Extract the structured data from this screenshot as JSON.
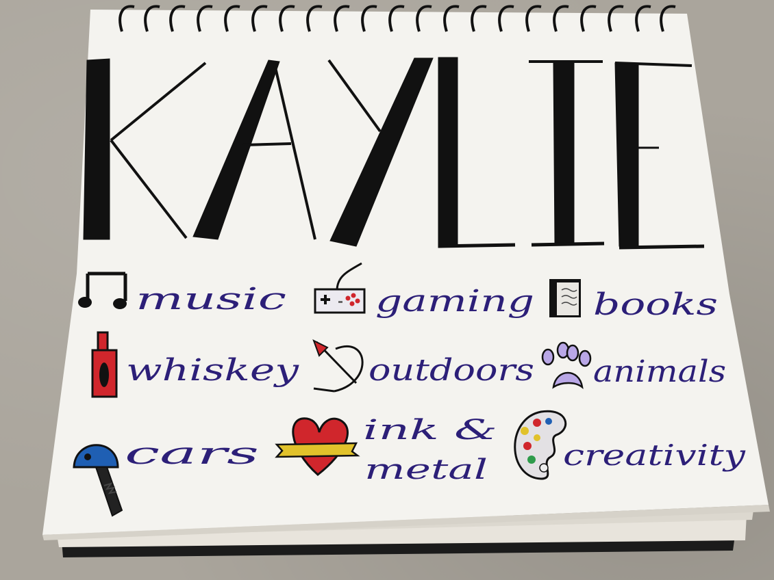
{
  "title": "KAYLIE",
  "interests": [
    {
      "icon": "music-note-icon",
      "label": "music"
    },
    {
      "icon": "game-controller-icon",
      "label": "gaming"
    },
    {
      "icon": "book-icon",
      "label": "books"
    },
    {
      "icon": "whiskey-bottle-icon",
      "label": "whiskey"
    },
    {
      "icon": "bow-arrow-icon",
      "label": "outdoors"
    },
    {
      "icon": "paw-print-icon",
      "label": "animals"
    },
    {
      "icon": "car-key-icon",
      "label": "cars"
    },
    {
      "icon": "heart-banner-icon",
      "label": "ink &"
    },
    {
      "icon": "heart-banner-icon",
      "label": "metal"
    },
    {
      "icon": "paint-palette-icon",
      "label": "creativity"
    }
  ],
  "colors": {
    "table": "#aaa59c",
    "paper": "#f4f3ef",
    "ink_black": "#111111",
    "ink_purple": "#2c1f78",
    "red": "#d0262c",
    "blue": "#1f5fb3",
    "yellow": "#e1c22b"
  }
}
